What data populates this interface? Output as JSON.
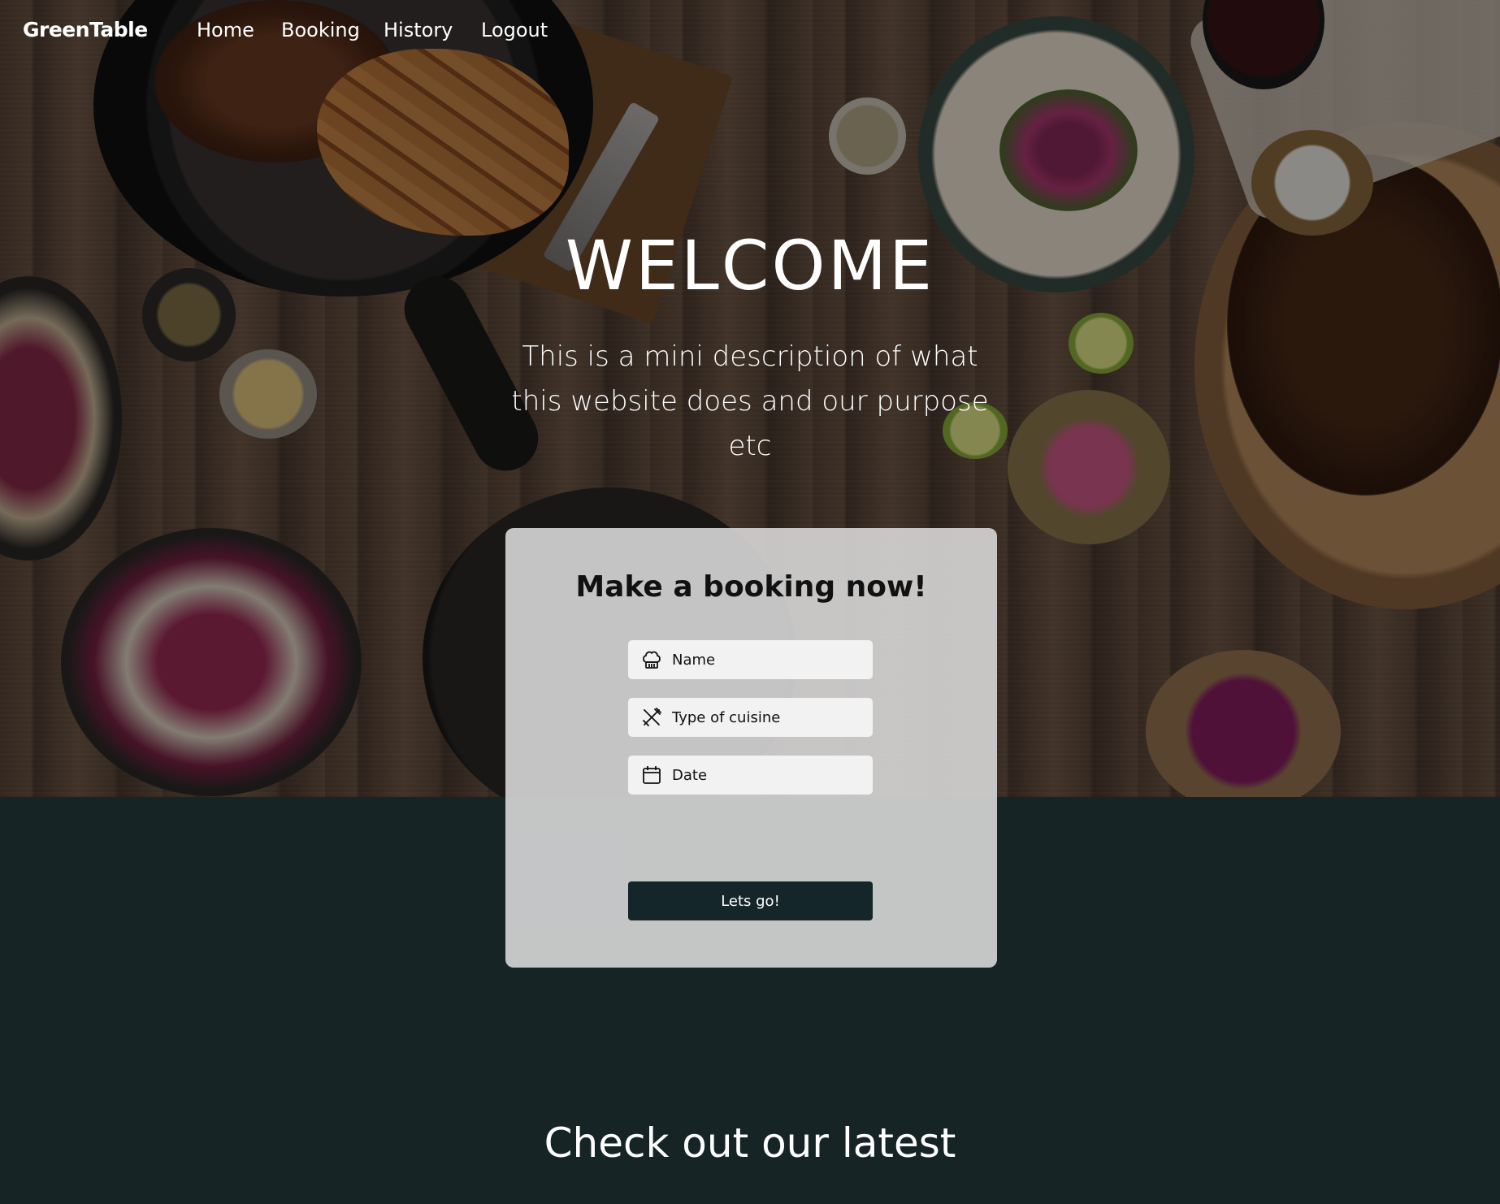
{
  "nav": {
    "brand": "GreenTable",
    "links": [
      {
        "label": "Home"
      },
      {
        "label": "Booking"
      },
      {
        "label": "History"
      },
      {
        "label": "Logout"
      }
    ]
  },
  "hero": {
    "title": "WELCOME",
    "description": "This is a mini description of what this website does and our purpose etc"
  },
  "booking": {
    "title": "Make a booking now!",
    "fields": [
      {
        "placeholder": "Name",
        "value": "",
        "icon": "chef-hat-icon"
      },
      {
        "placeholder": "Type of cuisine",
        "value": "",
        "icon": "fork-knife-icon"
      },
      {
        "placeholder": "Date",
        "value": "",
        "icon": "calendar-icon"
      }
    ],
    "submit_label": "Lets go!"
  },
  "latest": {
    "title": "Check out our latest"
  },
  "colors": {
    "dark_teal": "#162426",
    "button": "#15262a",
    "card": "#d7d7d7"
  }
}
